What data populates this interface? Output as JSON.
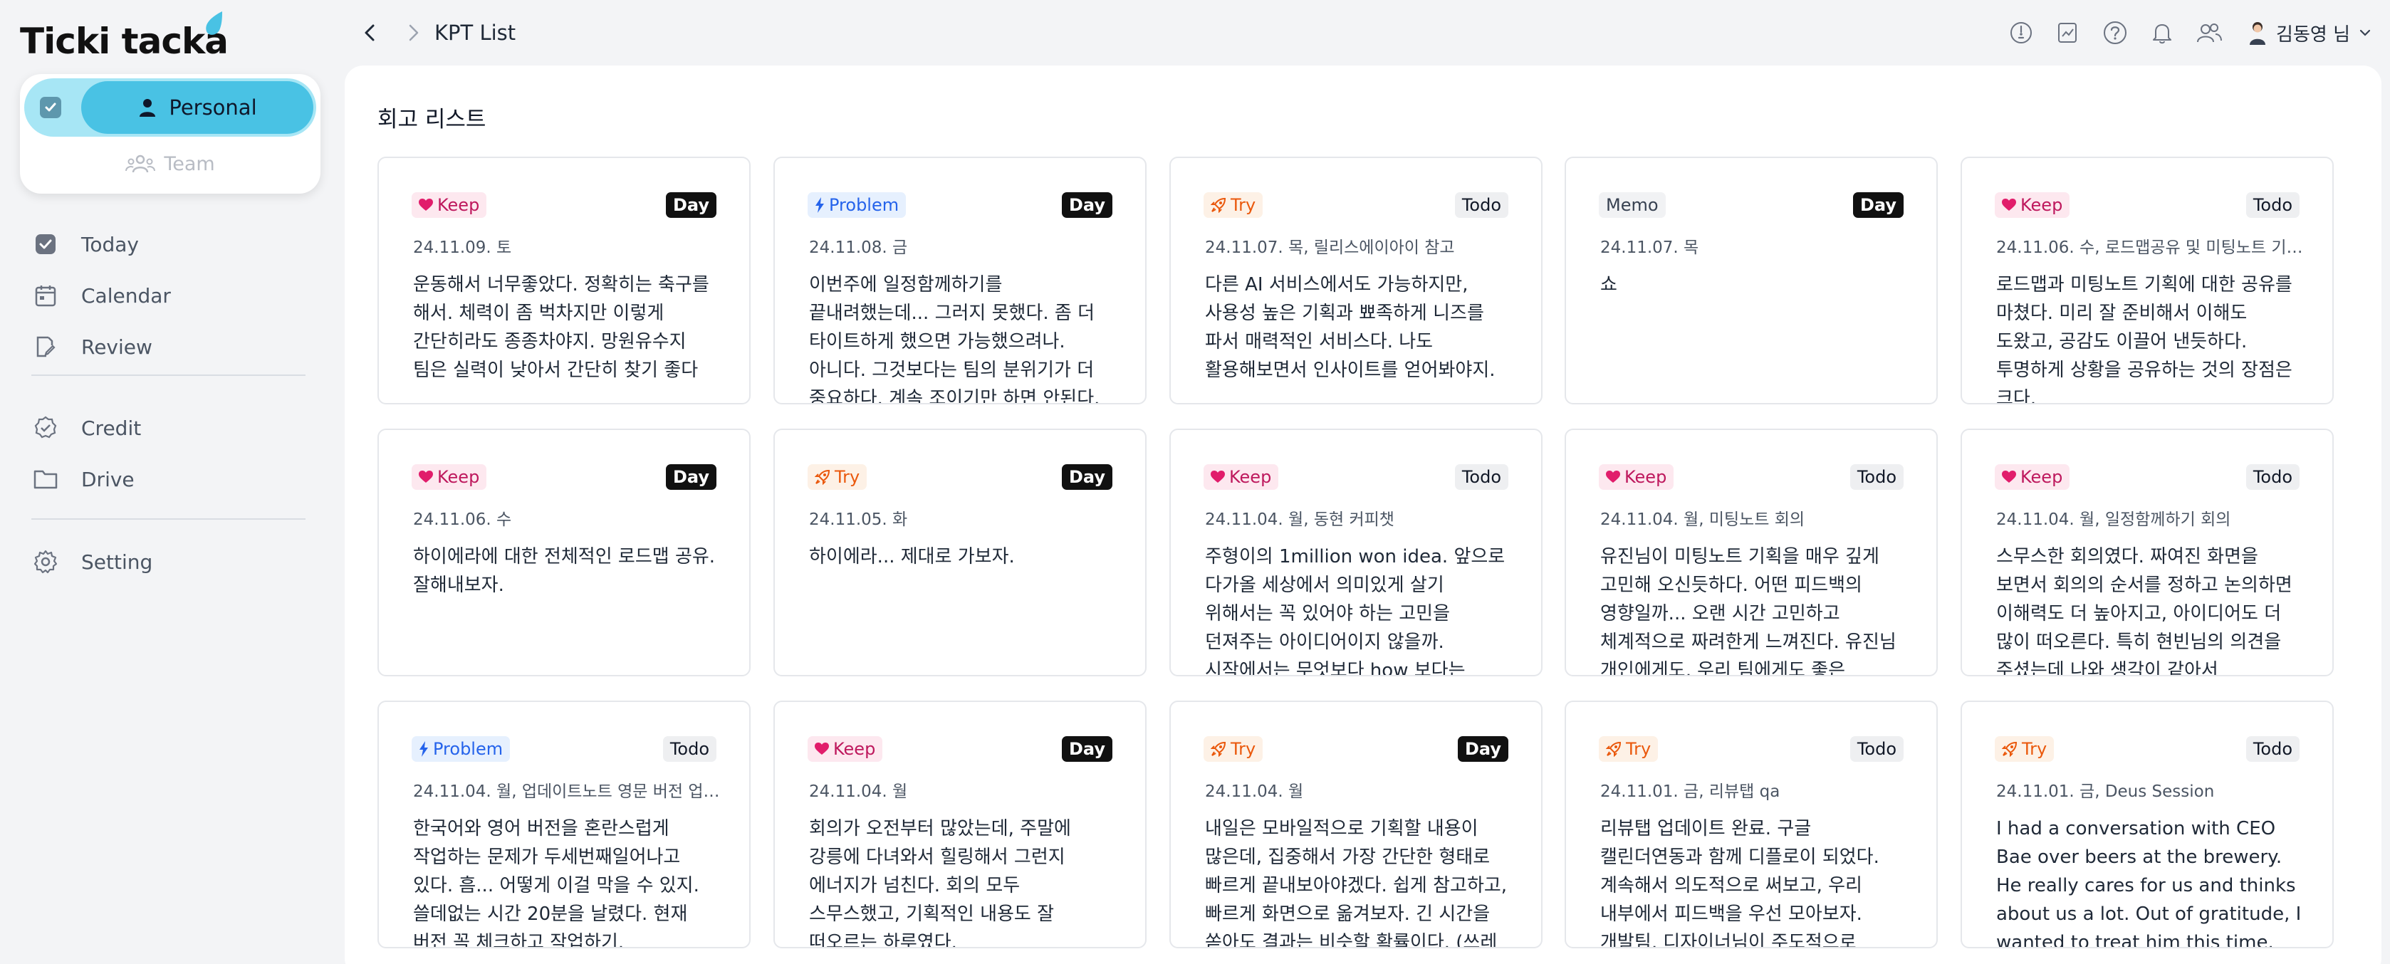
{
  "app": {
    "logo": "Ticki tacka",
    "brand_color": "#49c2e4"
  },
  "sidebar": {
    "switch": {
      "active_label": "Personal",
      "inactive_label": "Team"
    },
    "items": [
      {
        "label": "Today",
        "icon": "check-square-icon"
      },
      {
        "label": "Calendar",
        "icon": "calendar-icon"
      },
      {
        "label": "Review",
        "icon": "edit-note-icon"
      },
      {
        "label": "Credit",
        "icon": "badge-check-icon"
      },
      {
        "label": "Drive",
        "icon": "folder-icon"
      },
      {
        "label": "Setting",
        "icon": "gear-icon"
      }
    ]
  },
  "header": {
    "breadcrumb_title": "KPT List",
    "icons": [
      "lightbulb-icon",
      "chart-note-icon",
      "help-icon",
      "bell-icon",
      "people-icon"
    ],
    "user_name": "김동영 님"
  },
  "main": {
    "title": "회고 리스트",
    "cards": [
      {
        "tag": "Keep",
        "type": "Day",
        "date": "24.11.09. 토",
        "body": "운동해서 너무좋았다. 정확히는 축구를 해서. 체력이 좀 벅차지만 이렇게 간단히라도 종종차야지. 망원유수지 팀은 실력이 낮아서 간단히 찾기 좋다"
      },
      {
        "tag": "Problem",
        "type": "Day",
        "date": "24.11.08. 금",
        "body": "이번주에 일정함께하기를 끝내려했는데... 그러지 못했다. 좀 더 타이트하게 했으면 가능했으려나. 아니다. 그것보다는 팀의 분위기가 더 중요하다. 계속 조이기만 하면 안된다. 다만 오늘 끝내보"
      },
      {
        "tag": "Try",
        "type": "Todo",
        "date": "24.11.07. 목, 릴리스에이아이 참고",
        "body": "다른 AI 서비스에서도 가능하지만, 사용성 높은 기획과 뾰족하게 니즈를 파서 매력적인 서비스다. 나도 활용해보면서 인사이트를 얻어봐야지."
      },
      {
        "tag": "Memo",
        "type": "Day",
        "date": "24.11.07. 목",
        "body": "쇼"
      },
      {
        "tag": "Keep",
        "type": "Todo",
        "date": "24.11.06. 수, 로드맵공유 및 미팅노트 기획...",
        "body": "로드맵과 미팅노트 기획에 대한 공유를 마쳤다. 미리 잘 준비해서 이해도 도왔고, 공감도 이끌어 낸듯하다. 투명하게 상황을 공유하는 것의 장점은 크다."
      },
      {
        "tag": "Keep",
        "type": "Day",
        "date": "24.11.06. 수",
        "body": "하이에라에 대한 전체적인 로드맵 공유. 잘해내보자."
      },
      {
        "tag": "Try",
        "type": "Day",
        "date": "24.11.05. 화",
        "body": "하이에라... 제대로 가보자."
      },
      {
        "tag": "Keep",
        "type": "Todo",
        "date": "24.11.04. 월, 동현 커피챗",
        "body": "주형이의 1million won idea. 앞으로 다가올 세상에서 의미있게 살기 위해서는 꼭 있어야 하는 고민을 던져주는 아이디어이지 않을까. 시작에서는 무엇보다 how 보다는 why가 중요하다."
      },
      {
        "tag": "Keep",
        "type": "Todo",
        "date": "24.11.04. 월, 미팅노트 회의",
        "body": "유진님이 미팅노트 기획을 매우 깊게 고민해 오신듯하다. 어떤 피드백의 영향일까... 오랜 시간 고민하고 체계적으로 짜려한게 느껴진다. 유진님 개인에게도, 우리 팀에게도 좋은 일이다. 미팅 노트"
      },
      {
        "tag": "Keep",
        "type": "Todo",
        "date": "24.11.04. 월, 일정함께하기 회의",
        "body": "스무스한 회의였다. 짜여진 화면을 보면서 회의의 순서를 정하고 논의하면 이해력도 더 높아지고, 아이디어도 더 많이 떠오른다. 특히 현빈님의 의견을 주셨는데 나와 생각이 같아서(초대자에게만"
      },
      {
        "tag": "Problem",
        "type": "Todo",
        "date": "24.11.04. 월, 업데이트노트 영문 버전 업로드",
        "body": "한국어와 영어 버전을 혼란스럽게 작업하는 문제가 두세번째일어나고 있다. 흠... 어떻게 이걸 막을 수 있지. 쓸데없는 시간 20분을 날렸다. 현재 버전 꼭 체크하고 작업하기."
      },
      {
        "tag": "Keep",
        "type": "Day",
        "date": "24.11.04. 월",
        "body": "회의가 오전부터 많았는데, 주말에 강릉에 다녀와서 힐링해서 그런지 에너지가 넘친다. 회의 모두 스무스했고, 기획적인 내용도 잘 떠오르는 하루였다."
      },
      {
        "tag": "Try",
        "type": "Day",
        "date": "24.11.04. 월",
        "body": "내일은 모바일적으로 기획할 내용이 많은데, 집중해서 가장 간단한 형태로 빠르게 끝내보아야겠다. 쉽게 참고하고, 빠르게 화면으로 옮겨보자. 긴 시간을 쏟아도 결과는 비슷할 확률이다. (쓰레"
      },
      {
        "tag": "Try",
        "type": "Todo",
        "date": "24.11.01. 금, 리뷰탭 qa",
        "body": "리뷰탭 업데이트 완료. 구글 캘린더연동과 함께 디플로이 되었다. 계속해서 의도적으로 써보고, 우리 내부에서 피드백을 우선 모아보자. 개발팀, 디자이너님이 주도적으로 시작하여 나는 피드백과"
      },
      {
        "tag": "Try",
        "type": "Todo",
        "date": "24.11.01. 금, Deus Session",
        "body": "I had a conversation with CEO Bae over beers at the brewery. He really cares for us and thinks about us a lot. Out of gratitude, I wanted to treat him this time. The"
      }
    ]
  },
  "colors": {
    "keep": "#be185d",
    "problem": "#2563eb",
    "try": "#ea580c",
    "memo": "#374151"
  }
}
